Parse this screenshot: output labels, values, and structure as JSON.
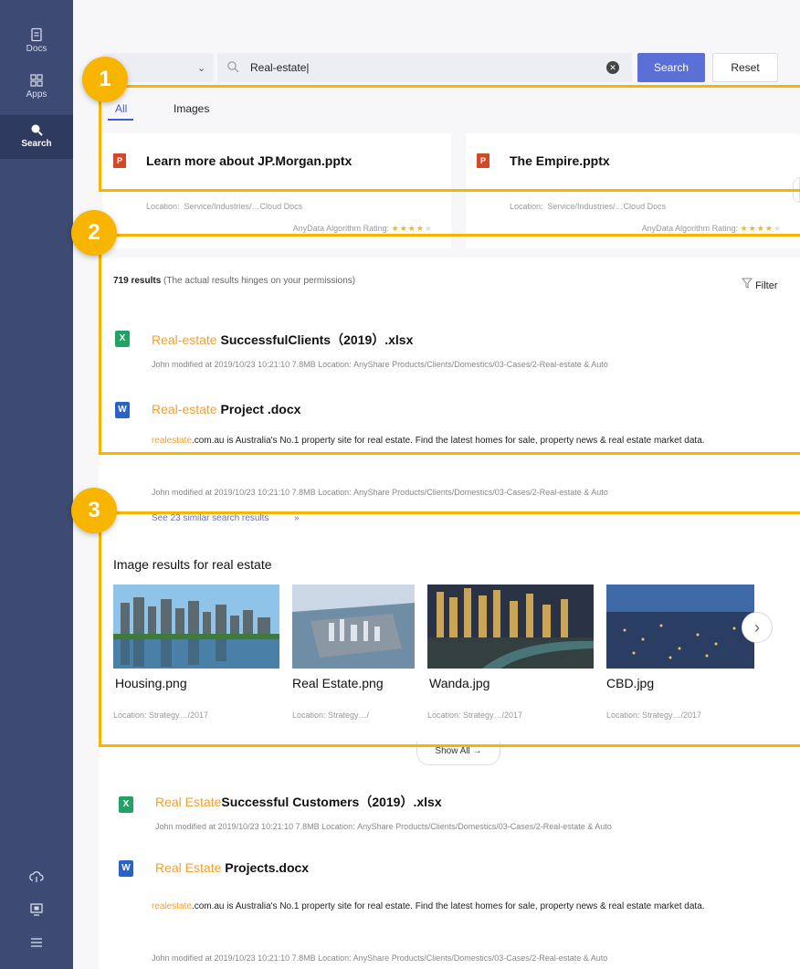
{
  "sidebar": {
    "items": [
      {
        "label": "Docs",
        "icon": "document-icon"
      },
      {
        "label": "Apps",
        "icon": "grid-icon"
      },
      {
        "label": "Search",
        "icon": "search-icon",
        "active": true
      }
    ],
    "bottom_icons": [
      "cloud-sync-icon",
      "monitor-icon",
      "menu-icon"
    ]
  },
  "search": {
    "query": "Real-estate|",
    "search_label": "Search",
    "reset_label": "Reset"
  },
  "tabs": [
    {
      "label": "All",
      "active": true
    },
    {
      "label": "Images",
      "active": false
    }
  ],
  "featured": [
    {
      "title": "Learn more about JP.Morgan.pptx",
      "location": "Location:  Service/Industries/…Cloud Docs",
      "rating_label": "AnyData Algorithm Rating:"
    },
    {
      "title": "The Empire.pptx",
      "location": "Location:  Service/Industries/…Cloud Docs",
      "rating_label": "AnyData Algorithm Rating:"
    }
  ],
  "results_summary": {
    "count": "719 results",
    "note": "(The actual results hinges on your permissions)",
    "filter_label": "Filter"
  },
  "results": [
    {
      "type": "xlsx",
      "highlight": "Real-estate",
      "title": " SuccessfulClients（2019）.xlsx",
      "meta": "John modified at  2019/10/23  10:21:10  7.8MB     Location: AnyShare Products/Clients/Domestics/03-Cases/2-Real-estate & Auto"
    },
    {
      "type": "docx",
      "highlight": "Real-estate",
      "title": " Project .docx",
      "snippet_highlight": "realestate",
      "snippet": ".com.au is Australia's No.1 property site for real estate. Find the latest homes for sale, property news & real estate market data.",
      "meta": "John modified at  2019/10/23  10:21:10  7.8MB     Location: AnyShare Products/Clients/Domestics/03-Cases/2-Real-estate & Auto",
      "similar": "See 23 similar search results"
    },
    {
      "type": "xlsx",
      "highlight": "Real Estate",
      "title": "Successful Customers（2019）.xlsx",
      "meta": "John modified at  2019/10/23  10:21:10  7.8MB     Location: AnyShare Products/Clients/Domestics/03-Cases/2-Real-estate & Auto"
    },
    {
      "type": "docx",
      "highlight": "Real Estate",
      "title": " Projects.docx",
      "snippet_highlight": "realestate",
      "snippet": ".com.au is Australia's No.1 property site for real estate. Find the latest homes for sale, property news & real estate market data.",
      "meta": "John modified at  2019/10/23  10:21:10  7.8MB     Location:     AnyShare Products/Clients/Domestics/03-Cases/2-Real-estate & Auto"
    }
  ],
  "image_results": {
    "heading": "Image results for real estate",
    "items": [
      {
        "name": "Housing.png",
        "location": "Location: Strategy…/2017"
      },
      {
        "name": "Real Estate.png",
        "location": "Location: Strategy…/"
      },
      {
        "name": "Wanda.jpg",
        "location": "Location: Strategy…/2017"
      },
      {
        "name": "CBD.jpg",
        "location": "Location: Strategy…/2017"
      }
    ],
    "show_all": "Show All"
  },
  "annotations": [
    "1",
    "2",
    "3"
  ],
  "colors": {
    "sidebar": "#3d4a74",
    "accent": "#5b6fd6",
    "highlight": "#f0a030",
    "annotation": "#f7b500"
  }
}
